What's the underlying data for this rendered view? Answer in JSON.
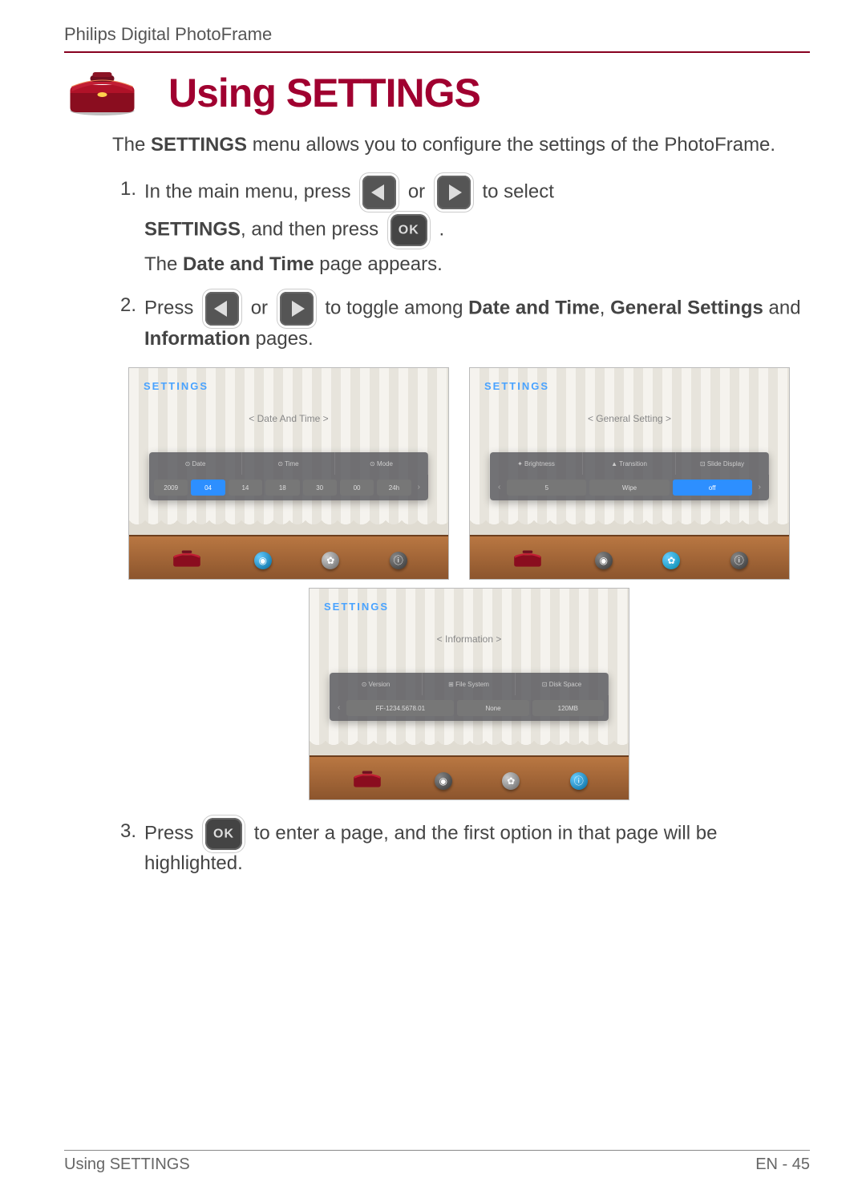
{
  "header": "Philips Digital PhotoFrame",
  "title": "Using SETTINGS",
  "intro_pre": "The ",
  "intro_bold": "SETTINGS",
  "intro_post": " menu allows you to configure the settings of the PhotoFrame.",
  "step1": {
    "num": "1.",
    "a": "In the main menu, press ",
    "or": " or ",
    "b": " to select ",
    "settings_bold": "SETTINGS",
    "c": ", and then press ",
    "dot": ".",
    "d_pre": "The ",
    "d_bold": "Date and Time",
    "d_post": " page appears."
  },
  "step2": {
    "num": "2.",
    "a": "Press ",
    "or": " or ",
    "b": " to toggle among ",
    "bold1": "Date and Time",
    "comma": ", ",
    "bold2": "General Settings",
    "and": " and ",
    "bold3": "Information",
    "c": " pages."
  },
  "step3": {
    "num": "3.",
    "a": "Press ",
    "b": " to enter a page, and the first option in that page will be highlighted."
  },
  "ok_label": "OK",
  "screens": {
    "title": "SETTINGS",
    "s1": {
      "tab": "<   Date And Time   >",
      "heads": [
        "⊙ Date",
        "⊙ Time",
        "⊙ Mode"
      ],
      "pills": [
        "2009",
        "04",
        "14",
        "18",
        "30",
        "00",
        "24h"
      ],
      "hl": 1
    },
    "s2": {
      "tab": "<   General Setting   >",
      "heads": [
        "✦ Brightness",
        "▲ Transition",
        "⊡ Slide Display"
      ],
      "pills": [
        "5",
        "Wipe",
        "off"
      ],
      "hl": 2
    },
    "s3": {
      "tab": "<   Information   >",
      "heads": [
        "⊙ Version",
        "⊞ File System",
        "⊡ Disk Space"
      ],
      "pills": [
        "FF-1234.5678.01",
        "None",
        "120MB"
      ],
      "hl": -1
    }
  },
  "footer": {
    "left": "Using SETTINGS",
    "right": "EN - 45"
  }
}
